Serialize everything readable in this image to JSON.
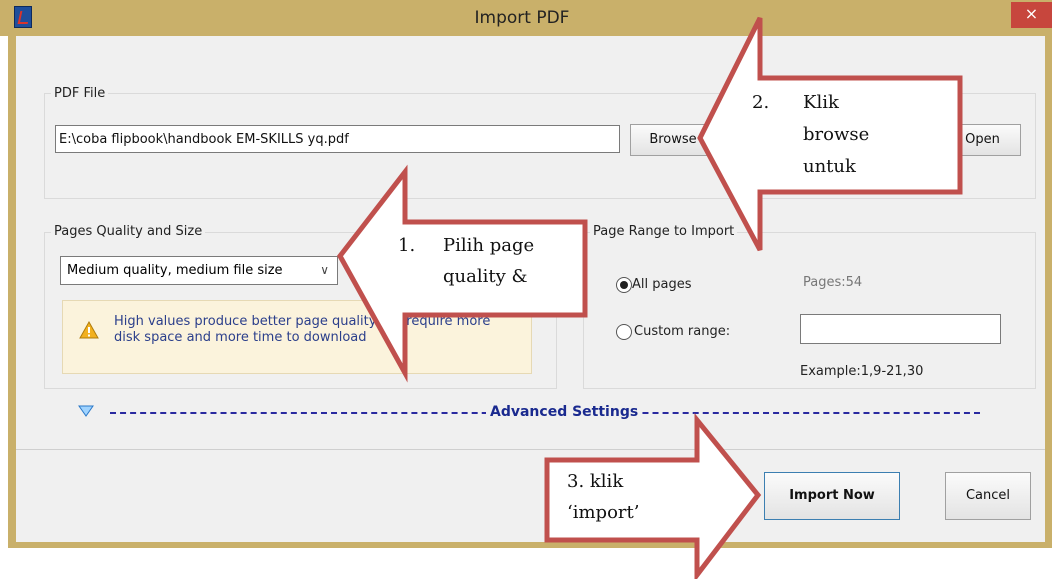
{
  "window": {
    "title": "Import PDF",
    "close_glyph": "×"
  },
  "pdf_file": {
    "group_label": "PDF File",
    "path_value": "E:\\coba flipbook\\handbook EM-SKILLS yq.pdf",
    "browse_label": "Browse",
    "open_label": "Open"
  },
  "quality": {
    "group_label": "Pages Quality and Size",
    "selected_option": "Medium quality, medium file size",
    "warning_text": "High values produce better page quality but require more disk space and more time to download"
  },
  "page_range": {
    "group_label": "Page Range to Import",
    "all_pages_label": "All pages",
    "pages_count": "Pages:54",
    "custom_range_label": "Custom range:",
    "custom_range_value": "",
    "example_text": "Example:1,9-21,30"
  },
  "advanced": {
    "label": "Advanced Settings"
  },
  "footer": {
    "import_label": "Import Now",
    "cancel_label": "Cancel"
  },
  "callouts": {
    "c1": {
      "num": "1.",
      "line1": "Pilih page",
      "line2": "quality &"
    },
    "c2": {
      "num": "2.",
      "line1": "Klik",
      "line2": "browse",
      "line3": "untuk"
    },
    "c3": {
      "line1": "3. klik",
      "line2": "‘import’"
    }
  },
  "colors": {
    "titlebar": "#c9b06a",
    "close_button": "#c7463d",
    "arrow_fill": "#ffffff",
    "arrow_stroke": "#c0504d",
    "warning_bg": "#fbf3dc",
    "advanced_link": "#1a2a8f"
  },
  "icons": {
    "app": "pdf-app-icon",
    "warning": "warning-icon",
    "advanced_toggle": "triangle-down-icon",
    "dropdown": "chevron-down-icon"
  }
}
